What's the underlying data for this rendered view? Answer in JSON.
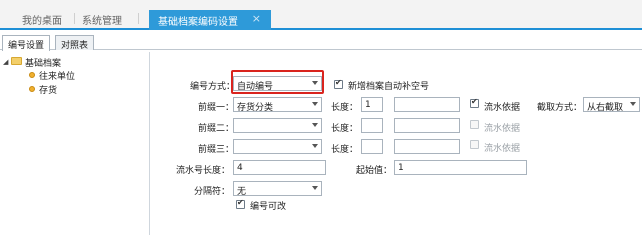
{
  "top_tabs": {
    "tab1": "我的桌面",
    "tab2": "系统管理",
    "active": "基础档案编码设置",
    "close_glyph": "×"
  },
  "sub_tabs": {
    "tab1": "编号设置",
    "tab2": "对照表"
  },
  "tree": {
    "toggle": "◢",
    "root": "基础档案",
    "children": [
      "往来单位",
      "存货"
    ]
  },
  "form": {
    "numbering_mode_label": "编号方式：",
    "numbering_mode_value": "自动编号",
    "auto_fill_label": "新增档案自动补空号",
    "prefix1_label": "前缀一：",
    "prefix1_value": "存货分类",
    "prefix2_label": "前缀二：",
    "prefix2_value": "",
    "prefix3_label": "前缀三：",
    "prefix3_value": "",
    "length_label": "长度：",
    "length1_value": "1",
    "length2_value": "",
    "length3_value": "",
    "serial_basis_label": "流水依据",
    "cut_mode_label": "截取方式：",
    "cut_mode_value": "从右截取",
    "serial_length_label": "流水号长度：",
    "serial_length_value": "4",
    "start_value_label": "起始值：",
    "start_value_value": "1",
    "separator_label": "分隔符：",
    "separator_value": "无",
    "editable_label": "编号可改"
  }
}
